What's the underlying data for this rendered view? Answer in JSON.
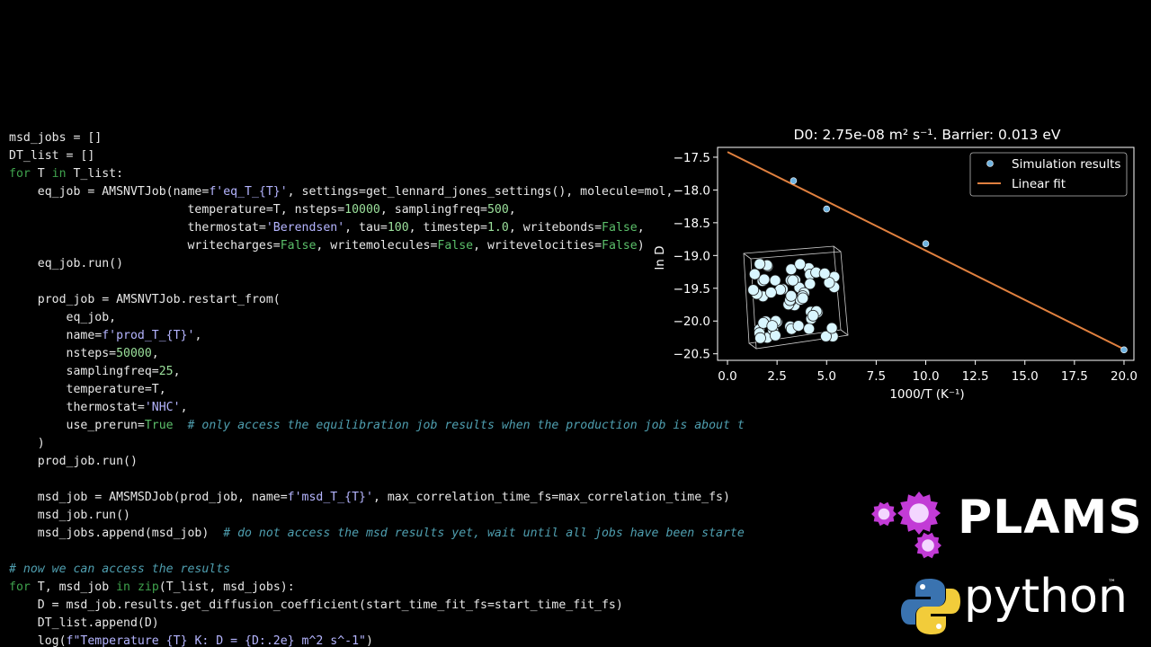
{
  "code": {
    "lines": [
      [
        {
          "t": "msd_jobs = []"
        }
      ],
      [
        {
          "t": "DT_list = []"
        }
      ],
      [
        {
          "t": "for",
          "c": "kw"
        },
        {
          "t": " T "
        },
        {
          "t": "in",
          "c": "kw"
        },
        {
          "t": " T_list:"
        }
      ],
      [
        {
          "t": "    eq_job = AMSNVTJob(name="
        },
        {
          "t": "f'eq_T_{T}'",
          "c": "str"
        },
        {
          "t": ", settings=get_lennard_jones_settings(), molecule=mol,"
        }
      ],
      [
        {
          "t": "                         temperature=T, nsteps="
        },
        {
          "t": "10000",
          "c": "num"
        },
        {
          "t": ", samplingfreq="
        },
        {
          "t": "500",
          "c": "num"
        },
        {
          "t": ","
        }
      ],
      [
        {
          "t": "                         thermostat="
        },
        {
          "t": "'Berendsen'",
          "c": "str"
        },
        {
          "t": ", tau="
        },
        {
          "t": "100",
          "c": "num"
        },
        {
          "t": ", timestep="
        },
        {
          "t": "1.0",
          "c": "num"
        },
        {
          "t": ", writebonds="
        },
        {
          "t": "False",
          "c": "bool"
        },
        {
          "t": ","
        }
      ],
      [
        {
          "t": "                         writecharges="
        },
        {
          "t": "False",
          "c": "bool"
        },
        {
          "t": ", writemolecules="
        },
        {
          "t": "False",
          "c": "bool"
        },
        {
          "t": ", writevelocities="
        },
        {
          "t": "False",
          "c": "bool"
        },
        {
          "t": ")"
        }
      ],
      [
        {
          "t": "    eq_job.run()"
        }
      ],
      [],
      [
        {
          "t": "    prod_job = AMSNVTJob.restart_from("
        }
      ],
      [
        {
          "t": "        eq_job,"
        }
      ],
      [
        {
          "t": "        name="
        },
        {
          "t": "f'prod_T_{T}'",
          "c": "str"
        },
        {
          "t": ","
        }
      ],
      [
        {
          "t": "        nsteps="
        },
        {
          "t": "50000",
          "c": "num"
        },
        {
          "t": ","
        }
      ],
      [
        {
          "t": "        samplingfreq="
        },
        {
          "t": "25",
          "c": "num"
        },
        {
          "t": ","
        }
      ],
      [
        {
          "t": "        temperature=T,"
        }
      ],
      [
        {
          "t": "        thermostat="
        },
        {
          "t": "'NHC'",
          "c": "str"
        },
        {
          "t": ","
        }
      ],
      [
        {
          "t": "        use_prerun="
        },
        {
          "t": "True",
          "c": "bool"
        },
        {
          "t": "  "
        },
        {
          "t": "# only access the equilibration job results when the production job is about t",
          "c": "com"
        }
      ],
      [
        {
          "t": "    )"
        }
      ],
      [
        {
          "t": "    prod_job.run()"
        }
      ],
      [],
      [
        {
          "t": "    msd_job = AMSMSDJob(prod_job, name="
        },
        {
          "t": "f'msd_T_{T}'",
          "c": "str"
        },
        {
          "t": ", max_correlation_time_fs=max_correlation_time_fs)"
        }
      ],
      [
        {
          "t": "    msd_job.run()"
        }
      ],
      [
        {
          "t": "    msd_jobs.append(msd_job)  "
        },
        {
          "t": "# do not access the msd results yet, wait until all jobs have been starte",
          "c": "com"
        }
      ],
      [],
      [
        {
          "t": "# now we can access the results",
          "c": "com"
        }
      ],
      [
        {
          "t": "for",
          "c": "kw"
        },
        {
          "t": " T, msd_job "
        },
        {
          "t": "in",
          "c": "kw"
        },
        {
          "t": " "
        },
        {
          "t": "zip",
          "c": "kw"
        },
        {
          "t": "(T_list, msd_jobs):"
        }
      ],
      [
        {
          "t": "    D = msd_job.results.get_diffusion_coefficient(start_time_fit_fs=start_time_fit_fs)"
        }
      ],
      [
        {
          "t": "    DT_list.append(D)"
        }
      ],
      [
        {
          "t": "    log("
        },
        {
          "t": "f\"Temperature {T} K: D = {D:.2e} m^2 s^-1\"",
          "c": "str"
        },
        {
          "t": ")"
        }
      ]
    ]
  },
  "chart_data": {
    "type": "scatter",
    "title": "D0: 2.75e-08 m² s⁻¹. Barrier: 0.013 eV",
    "xlabel": "1000/T (K⁻¹)",
    "ylabel": "ln D",
    "xlim": [
      -0.5,
      20.5
    ],
    "ylim": [
      -20.6,
      -17.35
    ],
    "xticks": [
      0.0,
      2.5,
      5.0,
      7.5,
      10.0,
      12.5,
      15.0,
      17.5,
      20.0
    ],
    "xtick_labels": [
      "0.0",
      "2.5",
      "5.0",
      "7.5",
      "10.0",
      "12.5",
      "15.0",
      "17.5",
      "20.0"
    ],
    "yticks": [
      -17.5,
      -18.0,
      -18.5,
      -19.0,
      -19.5,
      -20.0,
      -20.5
    ],
    "ytick_labels": [
      "−17.5",
      "−18.0",
      "−18.5",
      "−19.0",
      "−19.5",
      "−20.0",
      "−20.5"
    ],
    "legend_position": "top-right",
    "grid": false,
    "series": [
      {
        "name": "Simulation results",
        "kind": "scatter",
        "color": "#6fb3e0",
        "x": [
          3.33,
          5.0,
          10.0,
          20.0
        ],
        "y": [
          -17.86,
          -18.29,
          -18.82,
          -20.44
        ]
      },
      {
        "name": "Linear fit",
        "kind": "line",
        "color": "#e0803f",
        "x": [
          0.0,
          20.0
        ],
        "y": [
          -17.42,
          -20.43
        ]
      }
    ]
  },
  "logos": {
    "plams": "PLAMS",
    "python": "python",
    "tm": "™",
    "gear_color": "#c23bd6",
    "python_blue": "#3a73b0",
    "python_yellow": "#f2cc3a"
  }
}
